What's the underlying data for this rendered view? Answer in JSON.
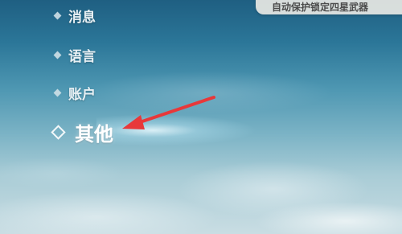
{
  "notice": {
    "text": "自动保护锁定四星武器"
  },
  "menu": {
    "items": [
      {
        "label": "消息"
      },
      {
        "label": "语言"
      },
      {
        "label": "账户"
      },
      {
        "label": "其他"
      }
    ],
    "selected": "其他"
  },
  "annotation": {
    "arrow_color": "#e8383a"
  },
  "colors": {
    "menu_text": "#e8f0f4",
    "selected_text": "#ffffff",
    "notice_bg": "#e8e8e4"
  }
}
